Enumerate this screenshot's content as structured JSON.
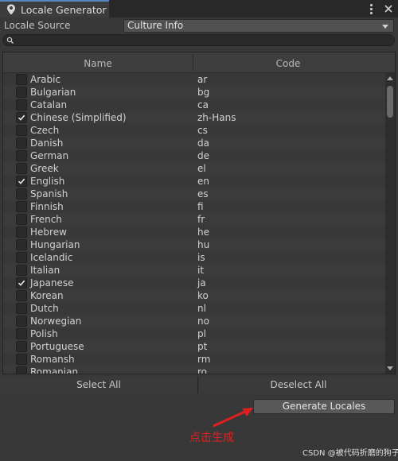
{
  "window": {
    "tab_title": "Locale Generator",
    "tab_icon": "location-pin-icon",
    "menu_icon": "kebab-menu-icon",
    "close_icon": "close-icon"
  },
  "locale_source": {
    "label": "Locale Source",
    "value": "Culture Info"
  },
  "search": {
    "value": "",
    "icon": "search-icon"
  },
  "table": {
    "columns": [
      "Name",
      "Code"
    ],
    "rows": [
      {
        "name": "Arabic",
        "code": "ar",
        "checked": false
      },
      {
        "name": "Bulgarian",
        "code": "bg",
        "checked": false
      },
      {
        "name": "Catalan",
        "code": "ca",
        "checked": false
      },
      {
        "name": "Chinese (Simplified)",
        "code": "zh-Hans",
        "checked": true
      },
      {
        "name": "Czech",
        "code": "cs",
        "checked": false
      },
      {
        "name": "Danish",
        "code": "da",
        "checked": false
      },
      {
        "name": "German",
        "code": "de",
        "checked": false
      },
      {
        "name": "Greek",
        "code": "el",
        "checked": false
      },
      {
        "name": "English",
        "code": "en",
        "checked": true
      },
      {
        "name": "Spanish",
        "code": "es",
        "checked": false
      },
      {
        "name": "Finnish",
        "code": "fi",
        "checked": false
      },
      {
        "name": "French",
        "code": "fr",
        "checked": false
      },
      {
        "name": "Hebrew",
        "code": "he",
        "checked": false
      },
      {
        "name": "Hungarian",
        "code": "hu",
        "checked": false
      },
      {
        "name": "Icelandic",
        "code": "is",
        "checked": false
      },
      {
        "name": "Italian",
        "code": "it",
        "checked": false
      },
      {
        "name": "Japanese",
        "code": "ja",
        "checked": true
      },
      {
        "name": "Korean",
        "code": "ko",
        "checked": false
      },
      {
        "name": "Dutch",
        "code": "nl",
        "checked": false
      },
      {
        "name": "Norwegian",
        "code": "no",
        "checked": false
      },
      {
        "name": "Polish",
        "code": "pl",
        "checked": false
      },
      {
        "name": "Portuguese",
        "code": "pt",
        "checked": false
      },
      {
        "name": "Romansh",
        "code": "rm",
        "checked": false
      },
      {
        "name": "Romanian",
        "code": "ro",
        "checked": false
      }
    ]
  },
  "buttons": {
    "select_all": "Select All",
    "deselect_all": "Deselect All",
    "generate": "Generate Locales"
  },
  "annotation": {
    "text": "点击生成",
    "color": "#e02020"
  },
  "watermark": "CSDN @被代码折磨的狗子",
  "colors": {
    "background": "#383838",
    "titlebar": "#282828",
    "tab_accent": "#5a86c0"
  }
}
